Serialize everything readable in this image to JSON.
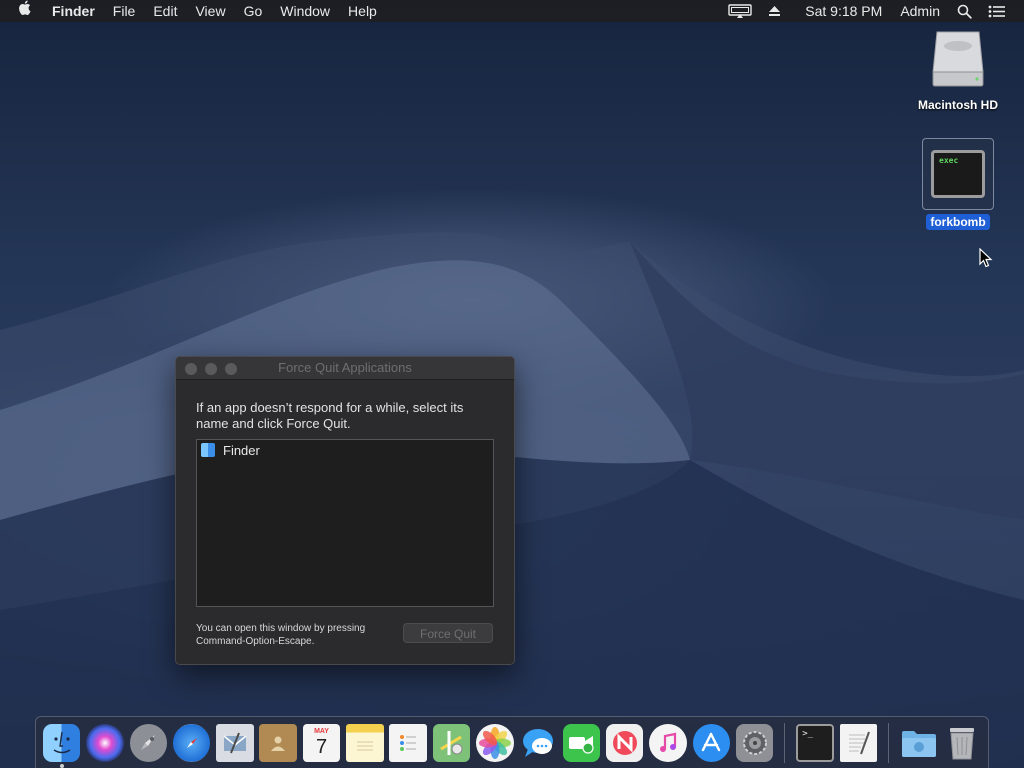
{
  "menubar": {
    "app_name": "Finder",
    "menus": [
      "File",
      "Edit",
      "View",
      "Go",
      "Window",
      "Help"
    ],
    "clock": "Sat 9:18 PM",
    "user": "Admin",
    "icons": [
      "apple-icon",
      "airplay-display-icon",
      "eject-icon",
      "spotlight-search-icon",
      "notification-center-icon"
    ]
  },
  "desktop": {
    "hd_label": "Macintosh HD",
    "forkbomb_label": "forkbomb",
    "forkbomb_icon_text": "exec"
  },
  "force_quit": {
    "title": "Force Quit Applications",
    "message": "If an app doesn’t respond for a while, select its name and click Force Quit.",
    "apps": [
      "Finder"
    ],
    "hint": "You can open this window by pressing Command-Option-Escape.",
    "button_label": "Force Quit"
  },
  "dock": {
    "apps": [
      {
        "icon": "finder-icon",
        "color": "#3b8fe6"
      },
      {
        "icon": "siri-icon",
        "color": "#7a3df0"
      },
      {
        "icon": "launchpad-icon",
        "color": "#8c8f96"
      },
      {
        "icon": "safari-icon",
        "color": "#2f86e8"
      },
      {
        "icon": "mail-icon",
        "color": "#d9dde3"
      },
      {
        "icon": "contacts-icon",
        "color": "#b08a52"
      },
      {
        "icon": "calendar-icon",
        "color": "#f4f4f4"
      },
      {
        "icon": "notes-icon",
        "color": "#f3d14f"
      },
      {
        "icon": "reminders-icon",
        "color": "#f4f4f4"
      },
      {
        "icon": "maps-icon",
        "color": "#7ec27a"
      },
      {
        "icon": "photos-icon",
        "color": "#f4f4f4"
      },
      {
        "icon": "messages-icon",
        "color": "#3aa2f5"
      },
      {
        "icon": "facetime-icon",
        "color": "#3cc44d"
      },
      {
        "icon": "news-icon",
        "color": "#f0f0f0"
      },
      {
        "icon": "itunes-icon",
        "color": "#f4f4f4"
      },
      {
        "icon": "app-store-icon",
        "color": "#2c8ef0"
      },
      {
        "icon": "system-preferences-icon",
        "color": "#8e9096"
      },
      {
        "icon": "terminal-icon",
        "color": "#1e1e1e"
      },
      {
        "icon": "textedit-icon",
        "color": "#f3f3f3"
      },
      {
        "icon": "downloads-folder-icon",
        "color": "#6eb2e6"
      },
      {
        "icon": "trash-icon",
        "color": "#b4b6ba"
      }
    ],
    "calendar_month": "MAY",
    "calendar_day": "7"
  }
}
